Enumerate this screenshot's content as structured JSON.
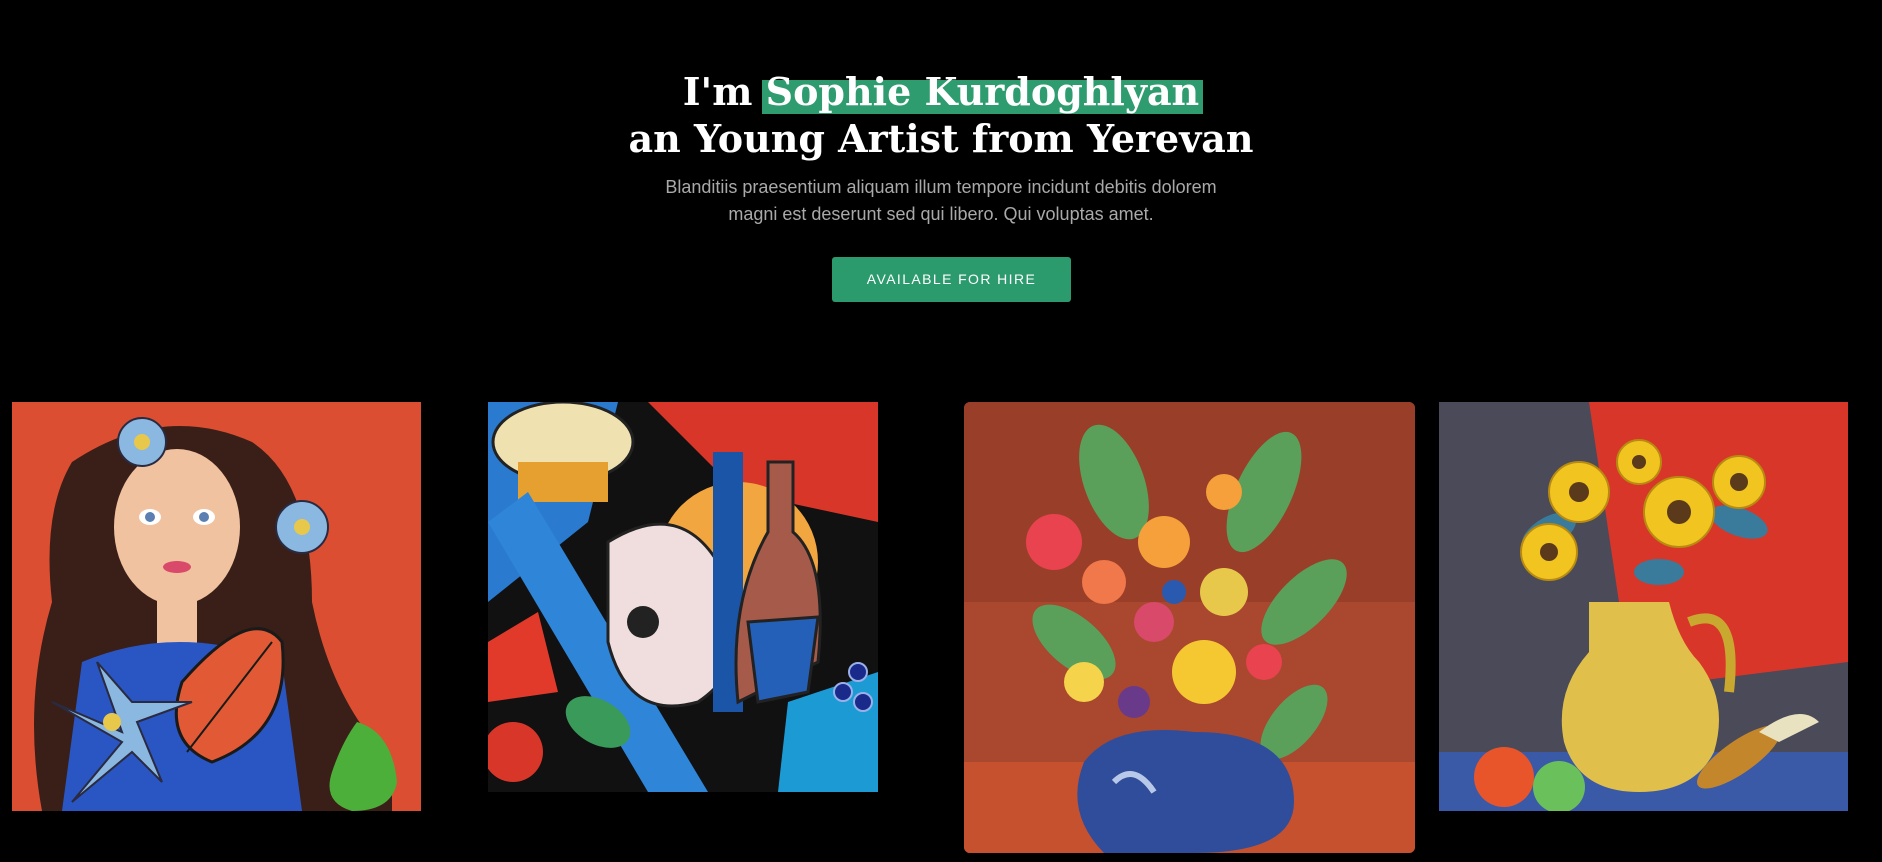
{
  "hero": {
    "title_prefix": "I'm ",
    "title_name": "Sophie Kurdoghlyan",
    "title_line2": "an Young Artist from Yerevan",
    "subtitle_line1": "Blanditiis praesentium aliquam illum tempore incidunt debitis dolorem",
    "subtitle_line2": "magni est deserunt sed qui libero. Qui voluptas amet.",
    "cta_label": "AVAILABLE FOR HIRE"
  },
  "colors": {
    "background": "#000000",
    "accent": "#2b9b6e",
    "subtitle": "#a9a9a9"
  },
  "gallery": {
    "items": [
      {
        "subject": "girl-with-flowers-painting"
      },
      {
        "subject": "cubist-guitar-bottle-painting"
      },
      {
        "subject": "flower-bouquet-in-blue-vase-painting"
      },
      {
        "subject": "sunflowers-in-yellow-jug-painting"
      }
    ]
  }
}
